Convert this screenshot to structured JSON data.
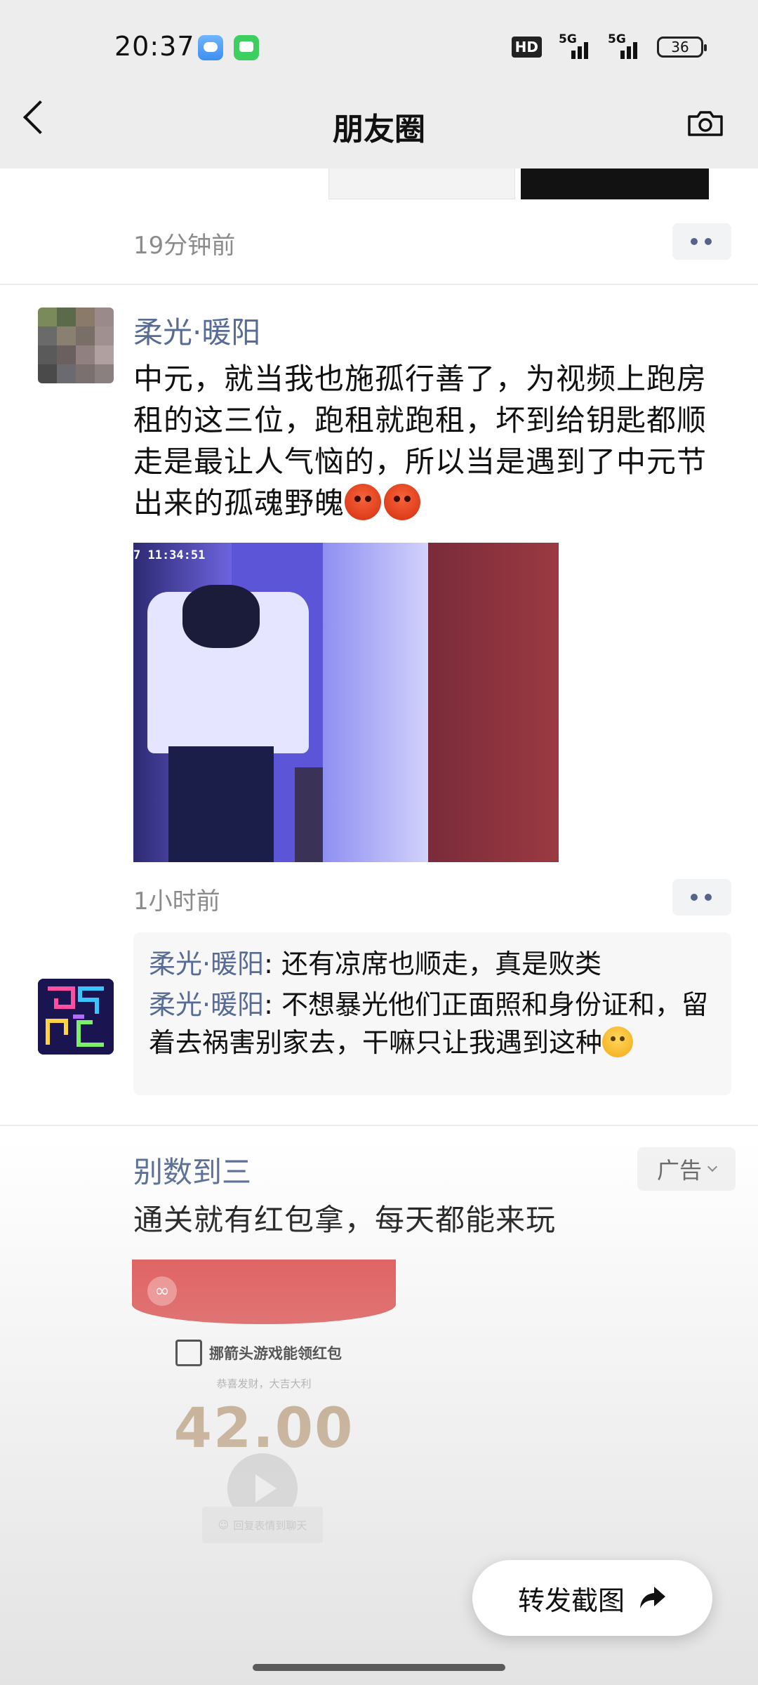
{
  "status_bar": {
    "time": "20:37",
    "hd_label": "HD",
    "network_1": "5G",
    "network_2": "5G",
    "battery": "36"
  },
  "nav": {
    "title": "朋友圈"
  },
  "prev_post": {
    "time": "19分钟前"
  },
  "post": {
    "author": "柔光·暖阳",
    "text": "中元，就当我也施孤行善了，为视频上跑房租的这三位，跑租就跑租，坏到给钥匙都顺走是最让人气恼的，所以当是遇到了中元节出来的孤魂野魄",
    "photo_timestamp": "7 11:34:51",
    "time": "1小时前",
    "comments": [
      {
        "author": "柔光·暖阳",
        "separator": ": ",
        "text": "还有凉席也顺走，真是败类"
      },
      {
        "author": "柔光·暖阳",
        "separator": ": ",
        "text": "不想暴光他们正面照和身份证和，留着去祸害别家去，干嘛只让我遇到这种"
      }
    ]
  },
  "ad": {
    "name": "别数到三",
    "badge": "广告",
    "text": "通关就有红包拿，每天都能来玩",
    "card_title": "挪箭头游戏能领红包",
    "card_subtitle": "恭喜发财，大吉大利",
    "amount": "42.00",
    "reply_label": "回复表情到聊天"
  },
  "share": {
    "label": "转发截图"
  },
  "colors": {
    "link_blue": "#576b95",
    "header_bg": "#ededed",
    "red_packet": "#e04848",
    "gold": "#b8946a"
  }
}
